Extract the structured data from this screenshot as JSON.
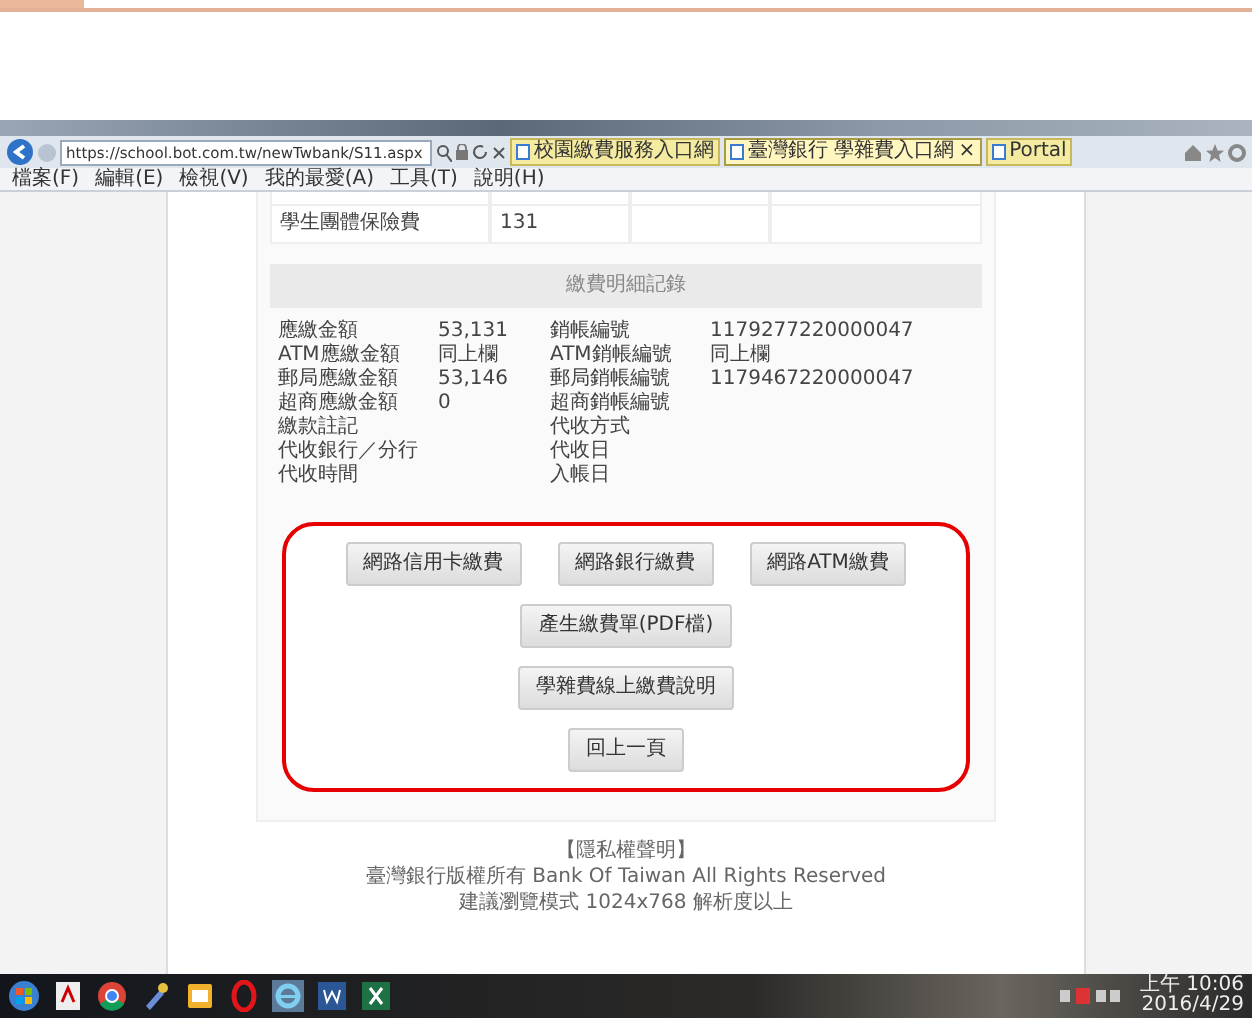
{
  "browser": {
    "url": "https://school.bot.com.tw/newTwbank/S11.aspx",
    "tabs": [
      {
        "label": "校園繳費服務入口網",
        "selected": false
      },
      {
        "label": "臺灣銀行 學雜費入口網",
        "selected": true
      },
      {
        "label": "Portal",
        "selected": false
      }
    ],
    "tab_close": "×",
    "menu": [
      "檔案(F)",
      "編輯(E)",
      "檢視(V)",
      "我的最愛(A)",
      "工具(T)",
      "說明(H)"
    ]
  },
  "fee_rows": [
    {
      "item": "學生團體保險費",
      "amount": "131"
    }
  ],
  "record_title": "繳費明細記錄",
  "details": [
    {
      "label": "應繳金額",
      "value": "53,131",
      "label_2": "銷帳編號",
      "value_2": "1179277220000047"
    },
    {
      "label": "ATM應繳金額",
      "value": "同上欄",
      "label_2": "ATM銷帳編號",
      "value_2": "同上欄"
    },
    {
      "label": "郵局應繳金額",
      "value": "53,146",
      "label_2": "郵局銷帳編號",
      "value_2": "1179467220000047"
    },
    {
      "label": "超商應繳金額",
      "value": "0",
      "label_2": "超商銷帳編號"
    },
    {
      "label": "繳款註記",
      "label_2": "代收方式"
    },
    {
      "label": "代收銀行／分行",
      "label_2": "代收日"
    },
    {
      "label": "代收時間",
      "label_2": "入帳日"
    }
  ],
  "actions": [
    [
      "網路信用卡繳費",
      "網路銀行繳費",
      "網路ATM繳費"
    ],
    [
      "產生繳費單(PDF檔)"
    ],
    [
      "學雜費線上繳費說明"
    ],
    [
      "回上一頁"
    ]
  ],
  "footer": {
    "link": "【隱私權聲明】",
    "copyright": "臺灣銀行版權所有 Bank Of Taiwan All Rights Reserved",
    "note": "建議瀏覽模式 1024x768 解析度以上"
  },
  "taskbar": {
    "time": "上午 10:06",
    "date": "2016/4/29"
  }
}
